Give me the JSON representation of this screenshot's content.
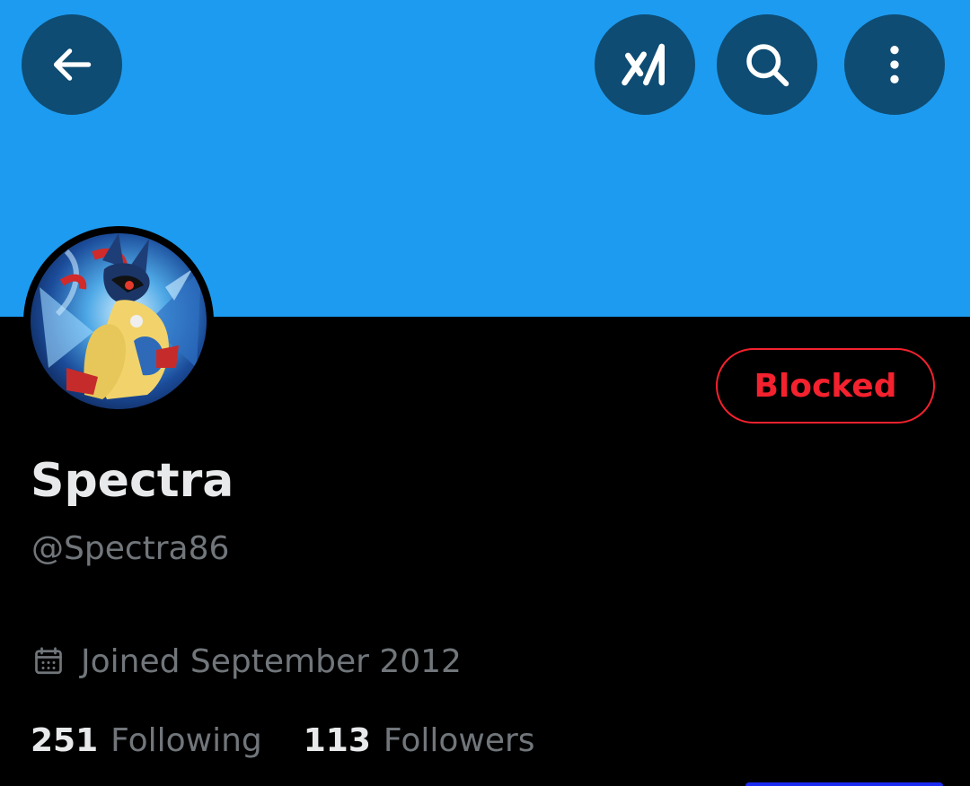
{
  "header": {
    "back_icon": "arrow-left-icon",
    "grok_icon": "grok-logo-icon",
    "search_icon": "search-icon",
    "more_icon": "more-vertical-icon",
    "banner_color": "#1D9BF0",
    "button_color": "#0E4C73"
  },
  "profile": {
    "display_name": "Spectra",
    "handle": "@Spectra86",
    "blocked_label": "Blocked",
    "blocked_color": "#F4212E",
    "joined_icon": "calendar-icon",
    "joined": "Joined September 2012"
  },
  "stats": {
    "following_count": "251",
    "following_label": "Following",
    "followers_count": "113",
    "followers_label": "Followers"
  }
}
